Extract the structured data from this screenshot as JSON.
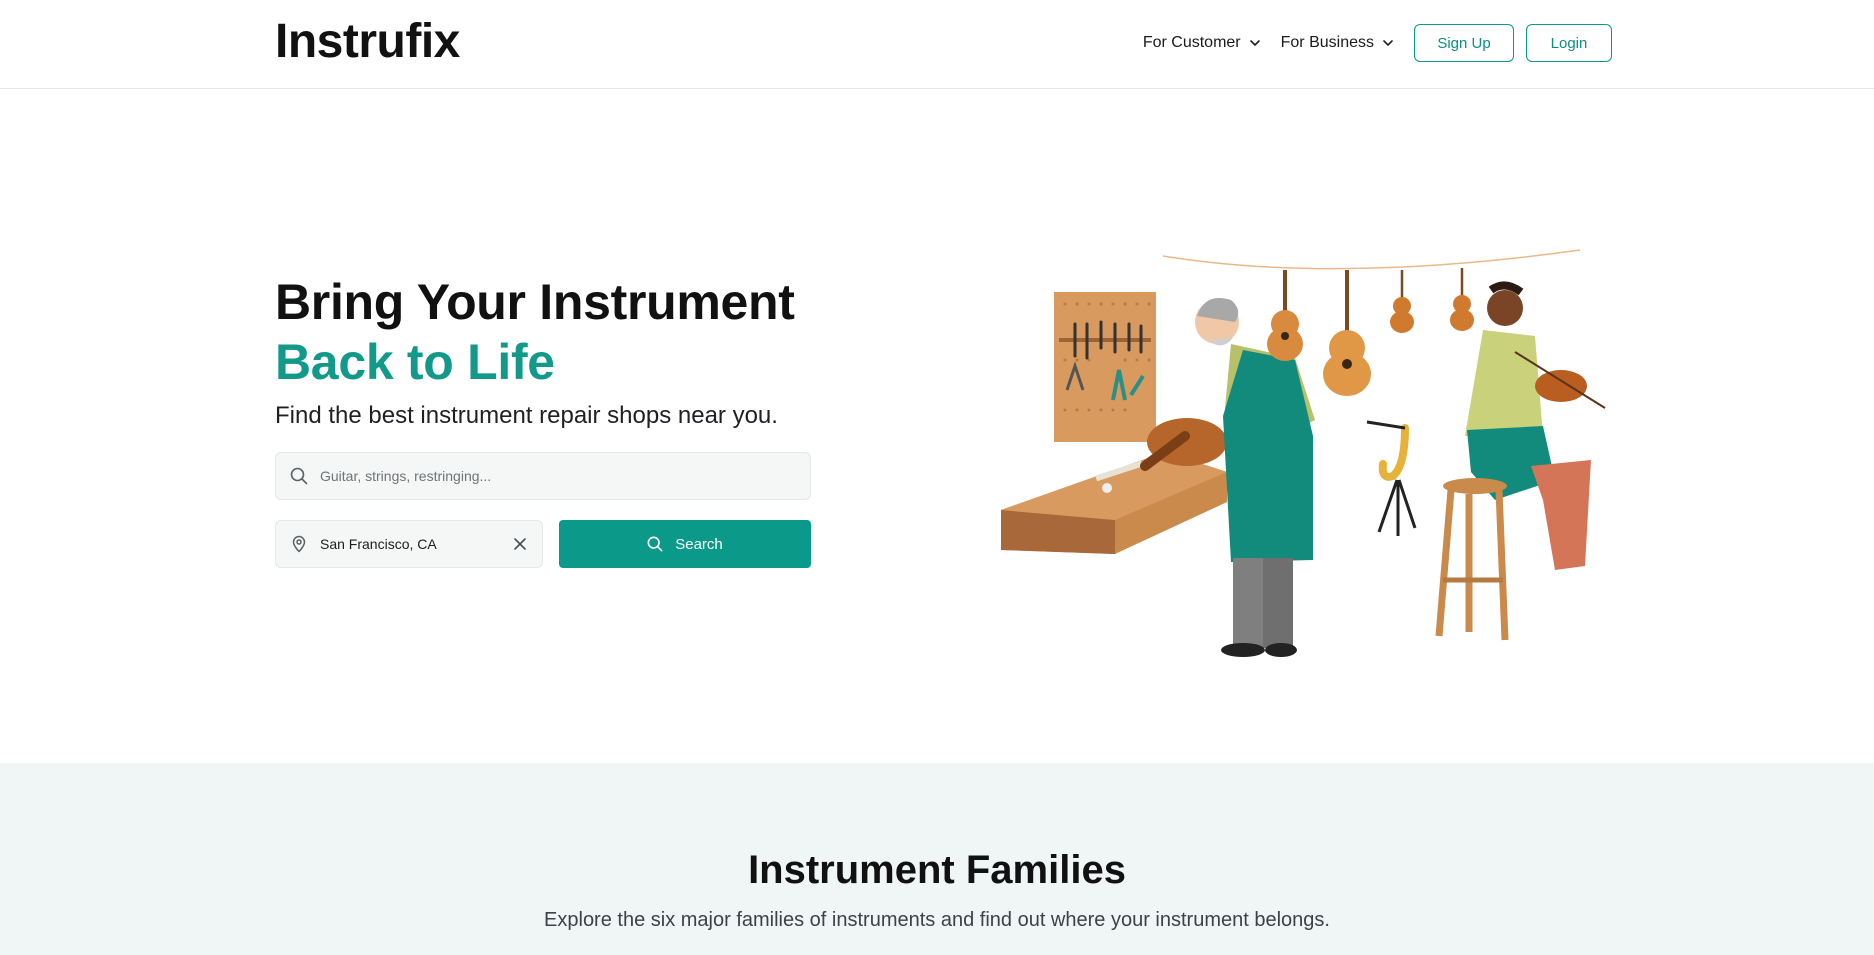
{
  "header": {
    "logo": "Instrufix",
    "nav": [
      {
        "label": "For Customer"
      },
      {
        "label": "For Business"
      }
    ],
    "signup_label": "Sign Up",
    "login_label": "Login"
  },
  "hero": {
    "title_line1": "Bring Your Instrument",
    "title_line2": "Back to Life",
    "subtitle": "Find the best instrument repair shops near you.",
    "search_placeholder": "Guitar, strings, restringing...",
    "location_value": "San Francisco, CA",
    "search_button": "Search"
  },
  "families": {
    "title": "Instrument Families",
    "subtitle": "Explore the six major families of instruments and find out where your instrument belongs."
  },
  "colors": {
    "accent": "#0b9a8a",
    "band_bg": "#f0f6f6"
  },
  "icons": [
    "chevron-down-icon",
    "search-icon",
    "location-pin-icon",
    "close-icon"
  ]
}
